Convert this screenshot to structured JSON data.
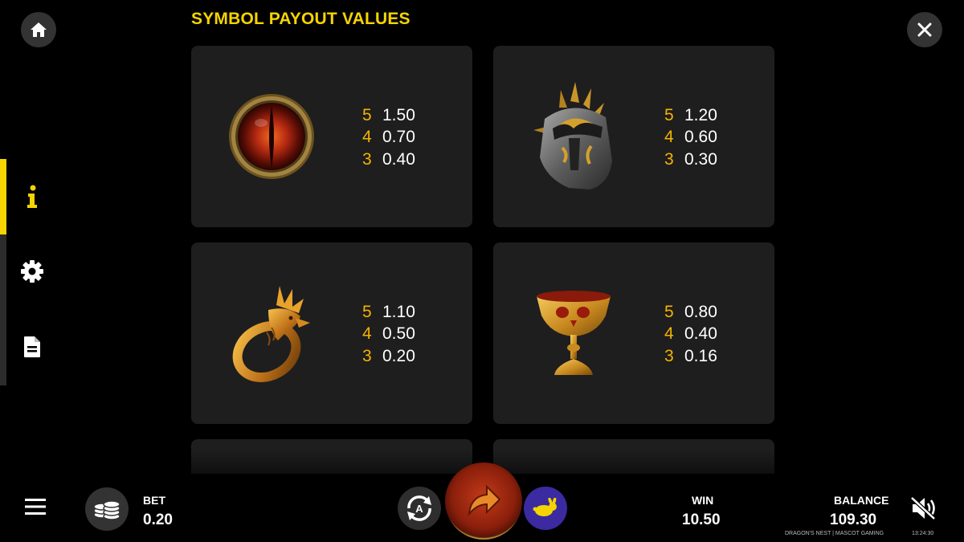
{
  "title": "SYMBOL PAYOUT VALUES",
  "cards": [
    {
      "symbol": "dragon-eye-icon",
      "payouts": [
        {
          "count": "5",
          "value": "1.50"
        },
        {
          "count": "4",
          "value": "0.70"
        },
        {
          "count": "3",
          "value": "0.40"
        }
      ]
    },
    {
      "symbol": "spiked-helmet-icon",
      "payouts": [
        {
          "count": "5",
          "value": "1.20"
        },
        {
          "count": "4",
          "value": "0.60"
        },
        {
          "count": "3",
          "value": "0.30"
        }
      ]
    },
    {
      "symbol": "dragon-ring-icon",
      "payouts": [
        {
          "count": "5",
          "value": "1.10"
        },
        {
          "count": "4",
          "value": "0.50"
        },
        {
          "count": "3",
          "value": "0.20"
        }
      ]
    },
    {
      "symbol": "skull-goblet-icon",
      "payouts": [
        {
          "count": "5",
          "value": "0.80"
        },
        {
          "count": "4",
          "value": "0.40"
        },
        {
          "count": "3",
          "value": "0.16"
        }
      ]
    }
  ],
  "bottom": {
    "bet_label": "BET",
    "bet_value": "0.20",
    "win_label": "WIN",
    "win_value": "10.50",
    "balance_label": "BALANCE",
    "balance_value": "109.30",
    "game_name": "DRAGON'S NEST | MASCOT GAMING",
    "clock": "13:24:30"
  },
  "colors": {
    "accent": "#f5d400",
    "count": "#f5b300",
    "card_bg": "#1e1e1e",
    "turbo": "#3b2aa0"
  }
}
